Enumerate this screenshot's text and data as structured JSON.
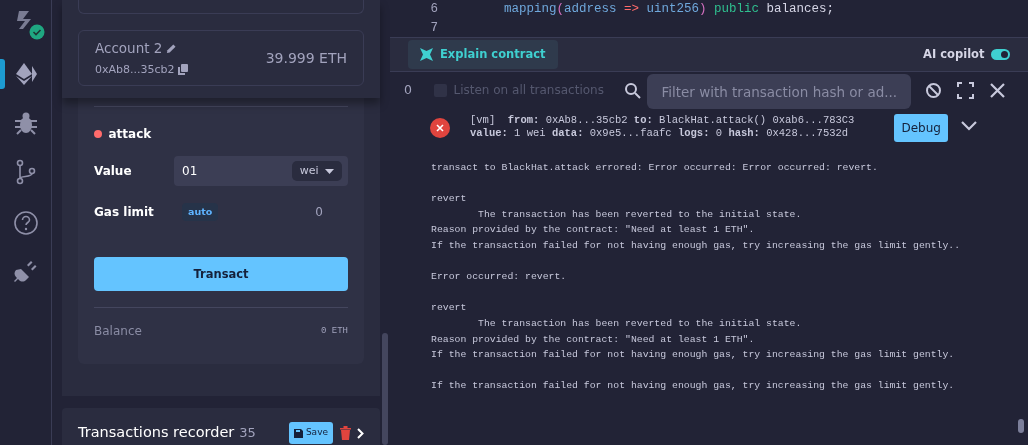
{
  "sidebar_icons": [
    {
      "kind": "logo",
      "selected": false
    },
    {
      "kind": "deploy",
      "selected": true
    },
    {
      "kind": "debug",
      "selected": false
    },
    {
      "kind": "git",
      "selected": false
    },
    {
      "kind": "help",
      "selected": false
    },
    {
      "kind": "plugin",
      "selected": false
    }
  ],
  "account": {
    "name": "Account 2",
    "address": "0xAb8...35cb2",
    "balance": "39.999 ETH"
  },
  "function": {
    "name": "attack",
    "color": "#ff6b6b",
    "value_label": "Value",
    "value": "01",
    "unit": "wei",
    "gas_label": "Gas limit",
    "gas_mode": "auto",
    "gas_value": "0",
    "button": "Transact",
    "balance_label": "Balance",
    "balance": "0 ETH"
  },
  "recorder": {
    "title": "Transactions recorder",
    "count": "35",
    "save": "Save"
  },
  "editor": {
    "lines": [
      {
        "number": "6",
        "tokens": [
          {
            "kind": "fn",
            "text": "mapping"
          },
          {
            "kind": "paren",
            "text": "("
          },
          {
            "kind": "type",
            "text": "address"
          },
          {
            "kind": "op",
            "text": " =>"
          },
          {
            "kind": "type",
            "text": " uint256"
          },
          {
            "kind": "paren",
            "text": ")"
          },
          {
            "kind": "kw",
            "text": " public"
          },
          {
            "kind": "plain",
            "text": " balances;"
          }
        ]
      },
      {
        "number": "7"
      }
    ]
  },
  "toolbar": {
    "explain": "Explain contract",
    "copilot_label": "AI copilot",
    "copilot_on": true
  },
  "terminal": {
    "count": "0",
    "listen_label": "Listen on all transactions",
    "listen_checked": false,
    "filter_placeholder": "Filter with transaction hash or ad...",
    "tx": {
      "line1": "[vm]  **from:** 0xAb8...35cb2 **to:** BlackHat.attack() 0xab6...783C3",
      "line2": "**value:** 1 wei **data:** 0x9e5...faafc **logs:** 0 **hash:** 0x428...7532d",
      "debug": "Debug"
    },
    "log": [
      [
        {
          "text": "transact to BlackHat.attack errored: Error occurred: Error occurred: revert.",
          "indented": false
        }
      ],
      [
        {
          "text": "revert",
          "indented": false
        },
        {
          "text": "The transaction has been reverted to the initial state.",
          "indented": true
        },
        {
          "text": "Reason provided by the contract: \"Need at least 1 ETH\".",
          "indented": false
        },
        {
          "text": "If the transaction failed for not having enough gas, try increasing the gas limit gently..",
          "indented": false
        }
      ],
      [
        {
          "text": "Error occurred: revert.",
          "indented": false
        }
      ],
      [
        {
          "text": "revert",
          "indented": false
        },
        {
          "text": "The transaction has been reverted to the initial state.",
          "indented": true
        },
        {
          "text": "Reason provided by the contract: \"Need at least 1 ETH\".",
          "indented": false
        },
        {
          "text": "If the transaction failed for not having enough gas, try increasing the gas limit gently.",
          "indented": false
        }
      ],
      [
        {
          "text": "If the transaction failed for not having enough gas, try increasing the gas limit gently.",
          "indented": false
        }
      ]
    ]
  }
}
